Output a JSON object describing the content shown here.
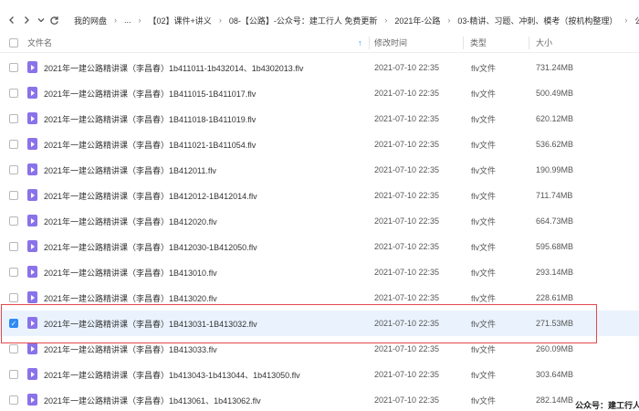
{
  "nav": {
    "back_icon": "chevron-left-icon",
    "forward_icon": "chevron-right-icon",
    "expand_icon": "chevron-down-icon",
    "refresh_icon": "refresh-icon",
    "breadcrumbs": [
      "我的网盘",
      "...",
      "【02】课件+讲义",
      "08-【公路】-公众号：建工行人 免费更新",
      "2021年-公路",
      "03-精讲、习题、冲刺、模考（按机构整理）",
      "公"
    ]
  },
  "header": {
    "filename": "文件名",
    "modified": "修改时间",
    "type": "类型",
    "size": "大小"
  },
  "files": [
    {
      "name": "2021年一建公路精讲课（李昌春）1b411011-1b432014、1b4302013.flv",
      "modified": "2021-07-10 22:35",
      "type": "flv文件",
      "size": "731.24MB",
      "checked": false
    },
    {
      "name": "2021年一建公路精讲课（李昌春）1B411015-1B411017.flv",
      "modified": "2021-07-10 22:35",
      "type": "flv文件",
      "size": "500.49MB",
      "checked": false
    },
    {
      "name": "2021年一建公路精讲课（李昌春）1B411018-1B411019.flv",
      "modified": "2021-07-10 22:35",
      "type": "flv文件",
      "size": "620.12MB",
      "checked": false
    },
    {
      "name": "2021年一建公路精讲课（李昌春）1B411021-1B411054.flv",
      "modified": "2021-07-10 22:35",
      "type": "flv文件",
      "size": "536.62MB",
      "checked": false
    },
    {
      "name": "2021年一建公路精讲课（李昌春）1B412011.flv",
      "modified": "2021-07-10 22:35",
      "type": "flv文件",
      "size": "190.99MB",
      "checked": false
    },
    {
      "name": "2021年一建公路精讲课（李昌春）1B412012-1B412014.flv",
      "modified": "2021-07-10 22:35",
      "type": "flv文件",
      "size": "711.74MB",
      "checked": false
    },
    {
      "name": "2021年一建公路精讲课（李昌春）1B412020.flv",
      "modified": "2021-07-10 22:35",
      "type": "flv文件",
      "size": "664.73MB",
      "checked": false
    },
    {
      "name": "2021年一建公路精讲课（李昌春）1B412030-1B412050.flv",
      "modified": "2021-07-10 22:35",
      "type": "flv文件",
      "size": "595.68MB",
      "checked": false
    },
    {
      "name": "2021年一建公路精讲课（李昌春）1B413010.flv",
      "modified": "2021-07-10 22:35",
      "type": "flv文件",
      "size": "293.14MB",
      "checked": false
    },
    {
      "name": "2021年一建公路精讲课（李昌春）1B413020.flv",
      "modified": "2021-07-10 22:35",
      "type": "flv文件",
      "size": "228.61MB",
      "checked": false
    },
    {
      "name": "2021年一建公路精讲课（李昌春）1B413031-1B413032.flv",
      "modified": "2021-07-10 22:35",
      "type": "flv文件",
      "size": "271.53MB",
      "checked": true
    },
    {
      "name": "2021年一建公路精讲课（李昌春）1B413033.flv",
      "modified": "2021-07-10 22:35",
      "type": "flv文件",
      "size": "260.09MB",
      "checked": false
    },
    {
      "name": "2021年一建公路精讲课（李昌春）1b413043-1b413044、1b413050.flv",
      "modified": "2021-07-10 22:35",
      "type": "flv文件",
      "size": "303.64MB",
      "checked": false
    },
    {
      "name": "2021年一建公路精讲课（李昌春）1b413061、1b413062.flv",
      "modified": "2021-07-10 22:35",
      "type": "flv文件",
      "size": "282.14MB",
      "checked": false
    }
  ],
  "watermark": "公众号：建工行人",
  "colors": {
    "selected_row": "#eaf3fd",
    "checkbox_checked": "#2f8bf2",
    "video_icon": "#8a72ea",
    "highlight_border": "#e5484d"
  }
}
